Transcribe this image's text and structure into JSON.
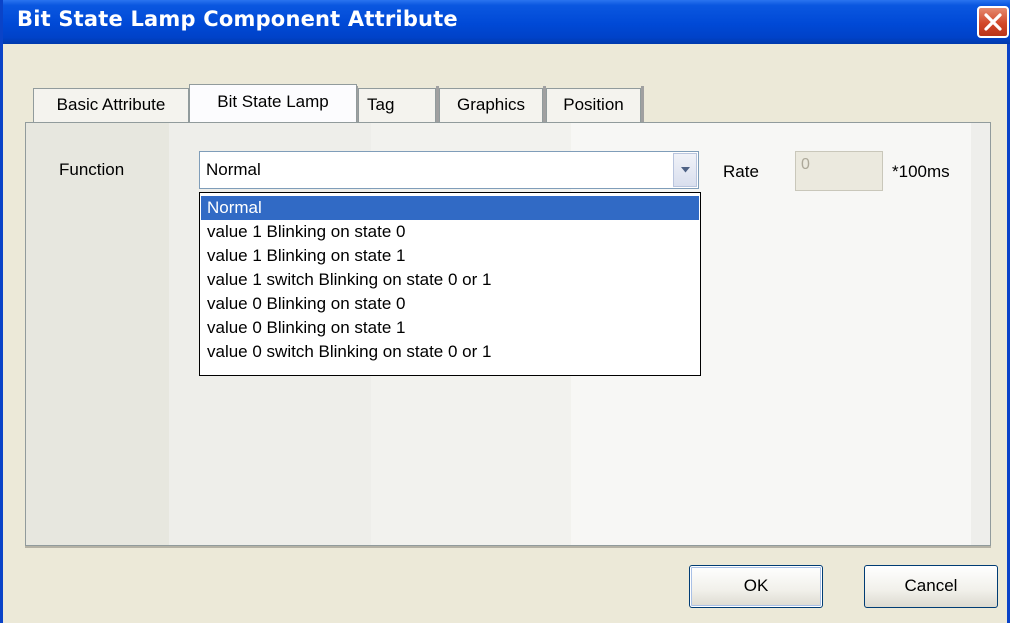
{
  "window": {
    "title": "Bit State Lamp Component Attribute"
  },
  "tabs": [
    {
      "label": "Basic Attribute",
      "active": false
    },
    {
      "label": "Bit State Lamp",
      "active": true
    },
    {
      "label": "Tag",
      "active": false
    },
    {
      "label": "Graphics",
      "active": false
    },
    {
      "label": "Position",
      "active": false
    }
  ],
  "function_field": {
    "label": "Function",
    "value": "Normal",
    "options": [
      "Normal",
      "value 1 Blinking on state 0",
      "value 1 Blinking on state 1",
      "value 1 switch Blinking on state 0 or 1",
      "value 0 Blinking on state 0",
      "value 0 Blinking on state 1",
      "value 0 switch Blinking on state 0 or 1"
    ],
    "selected_index": 0
  },
  "rate_field": {
    "label": "Rate",
    "value": "0",
    "unit": "*100ms",
    "enabled": false
  },
  "buttons": {
    "ok": "OK",
    "cancel": "Cancel"
  },
  "colors": {
    "titlebar": "#0049d6",
    "selection": "#316ac5",
    "dialog_bg": "#ece9d8"
  }
}
